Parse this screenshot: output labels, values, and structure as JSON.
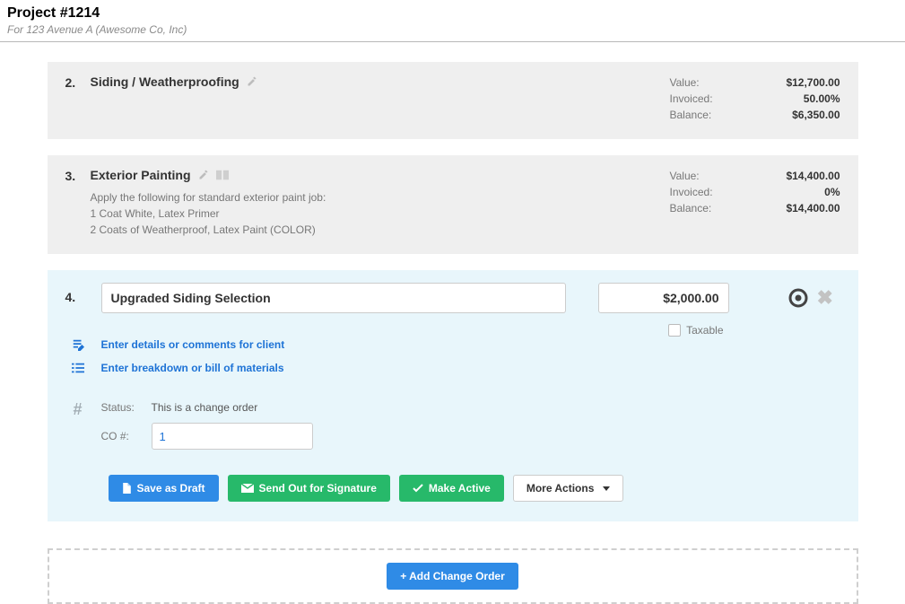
{
  "header": {
    "title": "Project #1214",
    "subtitle": "For 123 Avenue A (Awesome Co, Inc)"
  },
  "items": [
    {
      "num": "2.",
      "title": "Siding / Weatherproofing",
      "fin": {
        "value": "$12,700.00",
        "invoiced": "50.00%",
        "balance": "$6,350.00"
      }
    },
    {
      "num": "3.",
      "title": "Exterior Painting",
      "desc": [
        "Apply the following for standard exterior paint job:",
        "1 Coat White, Latex Primer",
        "2 Coats of Weatherproof, Latex Paint (COLOR)"
      ],
      "fin": {
        "value": "$14,400.00",
        "invoiced": "0%",
        "balance": "$14,400.00"
      }
    }
  ],
  "fin_labels": {
    "value": "Value:",
    "invoiced": "Invoiced:",
    "balance": "Balance:"
  },
  "editing": {
    "num": "4.",
    "title": "Upgraded Siding Selection",
    "value": "$2,000.00",
    "taxable_label": "Taxable",
    "links": {
      "details": "Enter details or comments for client",
      "breakdown": "Enter breakdown or bill of materials"
    },
    "status": {
      "status_label": "Status:",
      "status_text": "This is a change order",
      "co_label": "CO #:",
      "co_value": "1"
    },
    "buttons": {
      "save_draft": "Save as Draft",
      "send_sig": "Send Out for Signature",
      "make_active": "Make Active",
      "more_actions": "More Actions"
    }
  },
  "add_co_label": "+ Add Change Order"
}
